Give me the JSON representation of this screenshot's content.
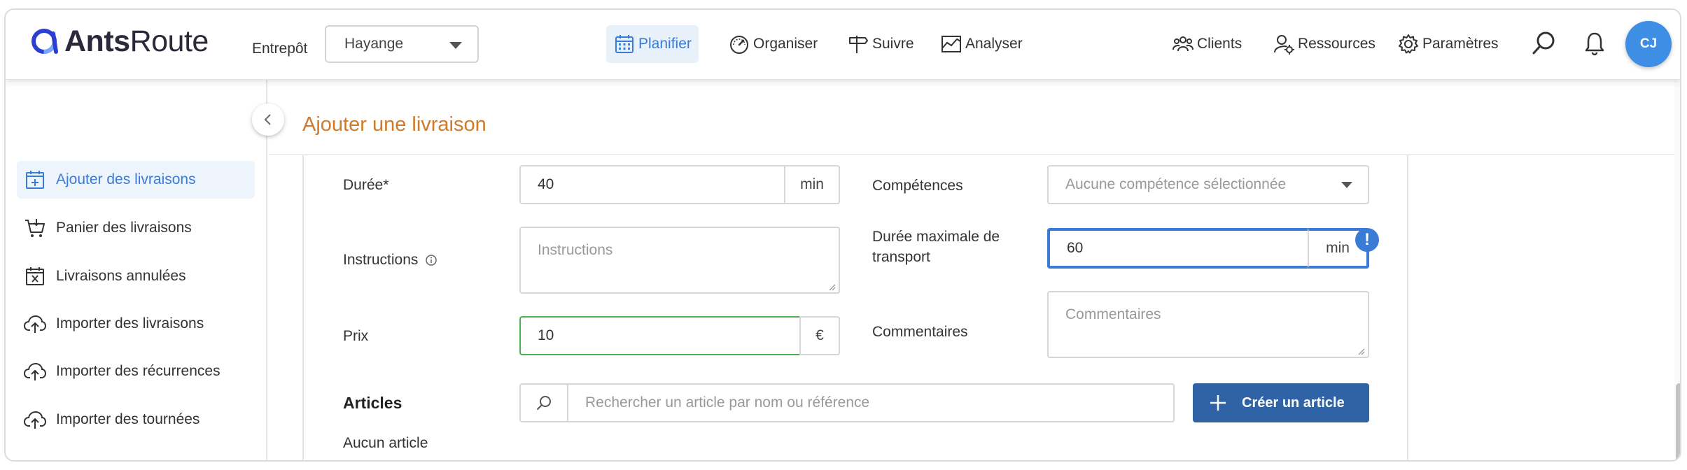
{
  "header": {
    "logo": {
      "brand_bold": "Ants",
      "brand_light": "Route"
    },
    "warehouse": {
      "label": "Entrepôt",
      "selected": "Hayange"
    },
    "nav": [
      {
        "label": "Planifier",
        "icon": "calendar-icon",
        "active": true
      },
      {
        "label": "Organiser",
        "icon": "gauge-icon",
        "active": false
      },
      {
        "label": "Suivre",
        "icon": "signpost-icon",
        "active": false
      },
      {
        "label": "Analyser",
        "icon": "chart-icon",
        "active": false
      }
    ],
    "right": [
      {
        "label": "Clients",
        "icon": "users-icon"
      },
      {
        "label": "Ressources",
        "icon": "user-gear-icon"
      },
      {
        "label": "Paramètres",
        "icon": "gear-icon"
      }
    ],
    "avatar_initials": "CJ"
  },
  "sidebar": {
    "items": [
      {
        "label": "Ajouter des livraisons",
        "icon": "calendar-add-icon",
        "active": true
      },
      {
        "label": "Panier des livraisons",
        "icon": "cart-icon",
        "active": false
      },
      {
        "label": "Livraisons annulées",
        "icon": "calendar-cancel-icon",
        "active": false
      },
      {
        "label": "Importer des livraisons",
        "icon": "cloud-upload-icon",
        "active": false
      },
      {
        "label": "Importer des récurrences",
        "icon": "cloud-upload-icon",
        "active": false
      },
      {
        "label": "Importer des tournées",
        "icon": "cloud-upload-icon",
        "active": false
      }
    ]
  },
  "page": {
    "title": "Ajouter une livraison"
  },
  "form": {
    "duree": {
      "label": "Durée*",
      "value": "40",
      "unit": "min"
    },
    "instructions": {
      "label": "Instructions",
      "placeholder": "Instructions"
    },
    "prix": {
      "label": "Prix",
      "value": "10",
      "unit": "€"
    },
    "competences": {
      "label": "Compétences",
      "placeholder": "Aucune compétence sélectionnée"
    },
    "duree_max": {
      "label_line1": "Durée maximale de",
      "label_line2": "transport",
      "value": "60",
      "unit": "min",
      "badge": "!"
    },
    "commentaires": {
      "label": "Commentaires",
      "placeholder": "Commentaires"
    }
  },
  "articles": {
    "title": "Articles",
    "search_placeholder": "Rechercher un article par nom ou référence",
    "create_label": "Créer un article",
    "empty_text": "Aucun article"
  },
  "colors": {
    "accent": "#3a7bd5",
    "title": "#d07b2c",
    "button": "#2f63a6",
    "valid_border": "#4caf50"
  }
}
